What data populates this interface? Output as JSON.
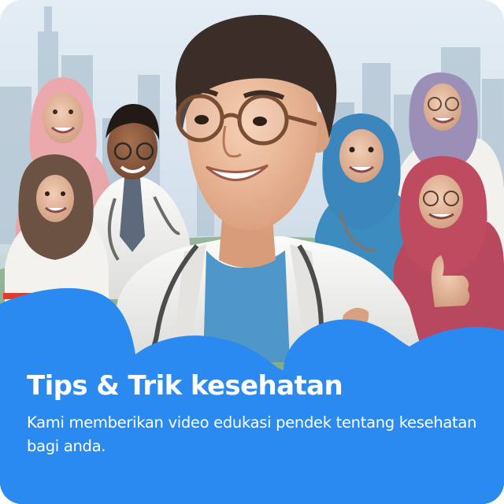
{
  "card": {
    "title": "Tips & Trik kesehatan",
    "description": "Kami memberikan video edukasi pendek tentang kesehatan bagi anda."
  },
  "hero": {
    "image": "doctor-and-medical-team-illustration"
  },
  "colors": {
    "panel": "#2b8af0",
    "text": "#ffffff",
    "coat": "#f3f2ef",
    "shirt": "#4f96c9"
  }
}
